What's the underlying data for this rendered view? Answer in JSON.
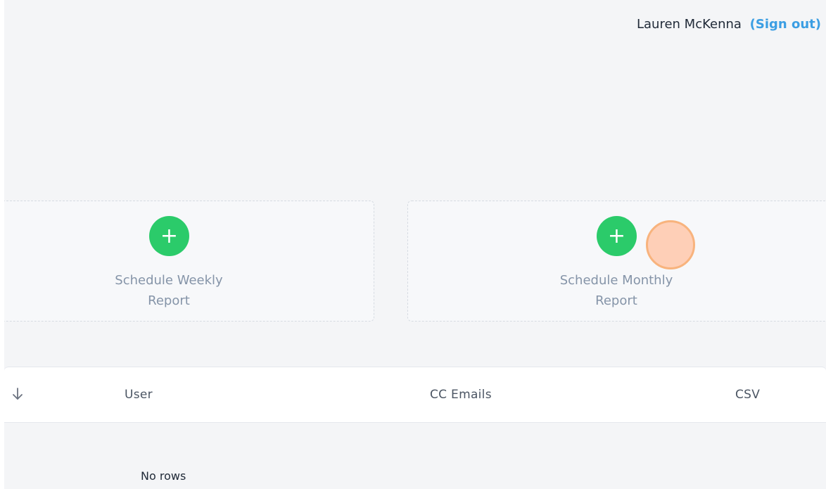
{
  "user": {
    "name": "Lauren McKenna",
    "sign_out_label": "(Sign out)"
  },
  "cards": {
    "weekly": {
      "icon": "plus-icon",
      "label_line1": "Schedule Weekly",
      "label_line2": "Report"
    },
    "monthly": {
      "icon": "plus-icon",
      "label_line1": "Schedule Monthly",
      "label_line2": "Report"
    }
  },
  "table": {
    "sort_icon": "arrow-down-icon",
    "columns": [
      "User",
      "CC Emails",
      "CSV"
    ],
    "empty_text": "No rows"
  },
  "colors": {
    "accent_green": "#2bcb6a",
    "link_blue": "#3b9ee3",
    "pointer": "#f8b37d"
  }
}
